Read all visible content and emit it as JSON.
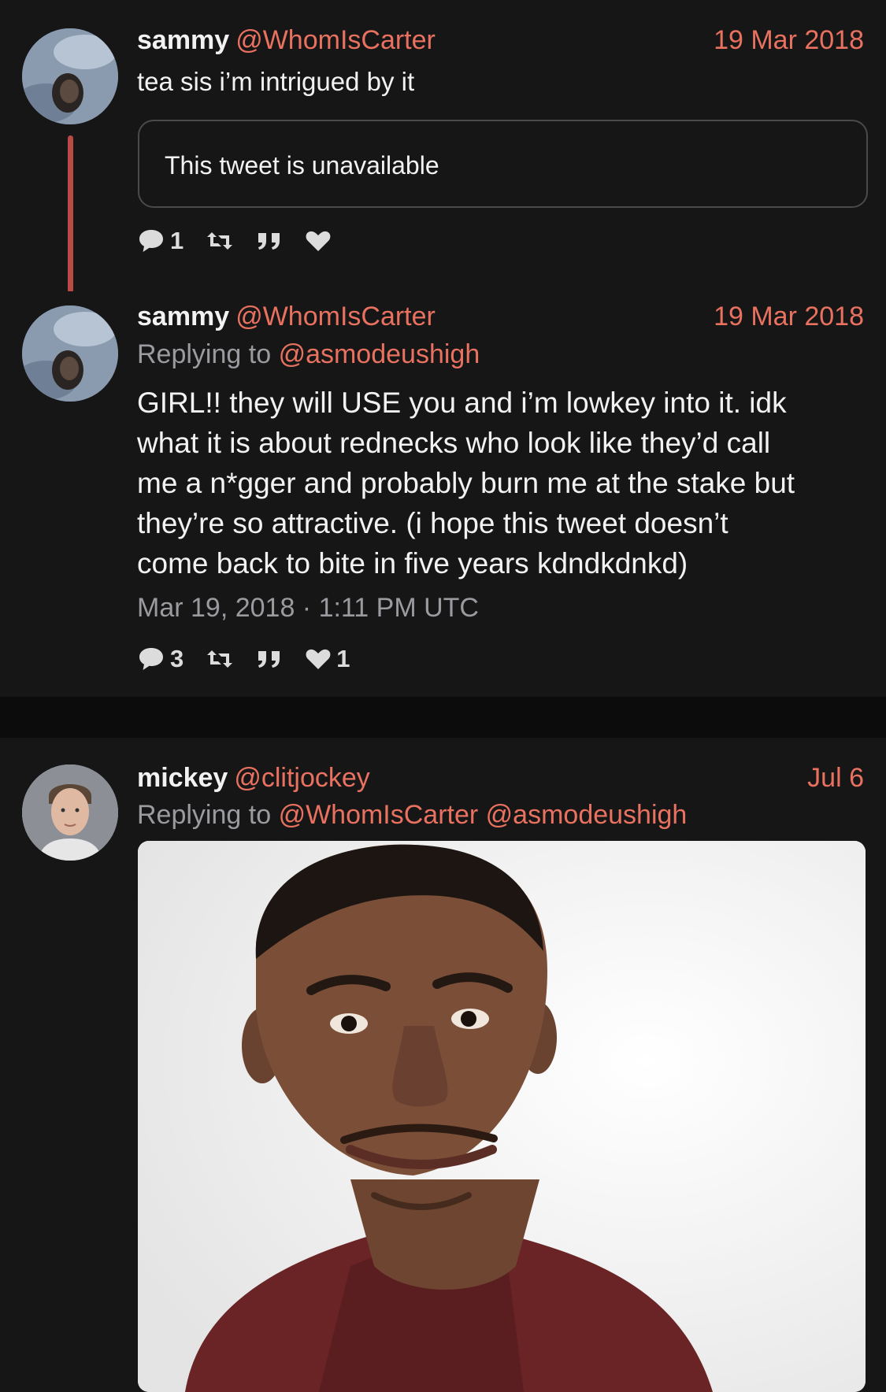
{
  "tweets": [
    {
      "name": "sammy",
      "handle": "@WhomIsCarter",
      "date": "19 Mar 2018",
      "text": "tea sis i’m intrigued by it",
      "quote": "This tweet is unavailable",
      "stats": {
        "replies": "1",
        "retweets": "",
        "quotes": "",
        "likes": ""
      }
    },
    {
      "name": "sammy",
      "handle": "@WhomIsCarter",
      "date": "19 Mar 2018",
      "replying_prefix": "Replying to",
      "replying_to": "@asmodeushigh",
      "text_lines": [
        "GIRL!! they will USE you and i’m lowkey into it. idk",
        "what it is about rednecks who look like they’d call",
        "me a n*gger and probably burn me at the stake but",
        "they’re so attractive. (i hope this tweet doesn’t",
        "come back to bite in five years kdndkdnkd)"
      ],
      "timestamp": "Mar 19, 2018 · 1:11 PM UTC",
      "stats": {
        "replies": "3",
        "retweets": "",
        "quotes": "",
        "likes": "1"
      }
    },
    {
      "name": "mickey",
      "handle": "@clitjockey",
      "date": "Jul 6",
      "replying_prefix": "Replying to",
      "replying_to": "@WhomIsCarter @asmodeushigh",
      "media": "photo-of-smiling-man"
    }
  ],
  "icons": {
    "reply": "speech-bubble-icon",
    "retweet": "retweet-icon",
    "quote": "quote-icon",
    "like": "heart-icon"
  },
  "colors": {
    "background": "#161617",
    "separator": "#0c0c0d",
    "accent": "#e8715f",
    "thread_line": "#b94a45",
    "text": "#f2f2f2",
    "muted": "#9a9a9f"
  }
}
